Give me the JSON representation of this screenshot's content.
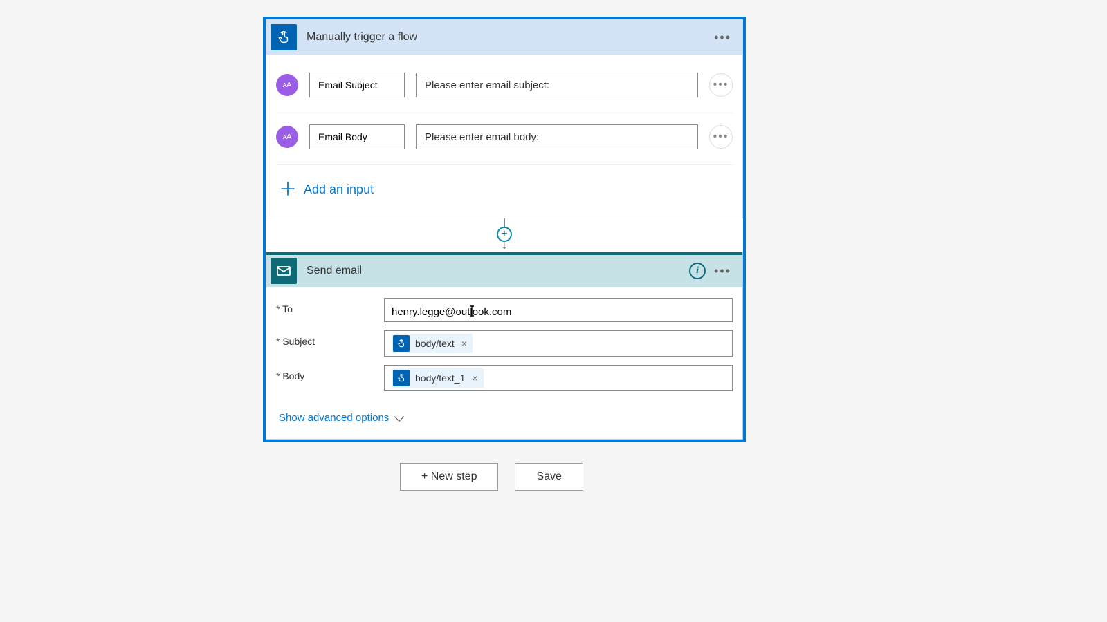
{
  "trigger": {
    "title": "Manually trigger a flow",
    "inputs": [
      {
        "name": "Email Subject",
        "prompt": "Please enter email subject:"
      },
      {
        "name": "Email Body",
        "prompt": "Please enter email body:"
      }
    ],
    "add_input_label": "Add an input"
  },
  "action": {
    "title": "Send email",
    "params": {
      "to_label": "To",
      "to_value": "henry.legge@outlook.com",
      "subject_label": "Subject",
      "subject_token": "body/text",
      "body_label": "Body",
      "body_token": "body/text_1"
    },
    "advanced_label": "Show advanced options"
  },
  "footer": {
    "new_step": "+ New step",
    "save": "Save"
  }
}
